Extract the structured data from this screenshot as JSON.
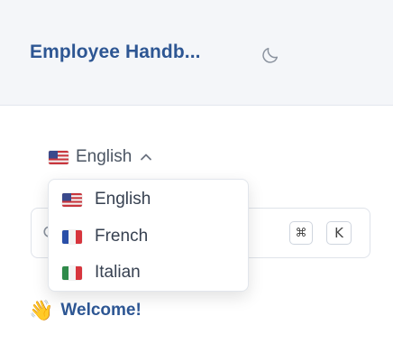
{
  "header": {
    "title": "Employee Handb...",
    "theme_toggle_icon": "moon-icon"
  },
  "language": {
    "current": "English",
    "current_flag": "us-flag",
    "toggle_icon": "chevron-up-icon",
    "options": [
      {
        "label": "English",
        "flag": "us-flag"
      },
      {
        "label": "French",
        "flag": "fr-flag"
      },
      {
        "label": "Italian",
        "flag": "it-flag"
      }
    ]
  },
  "search": {
    "icon": "search-icon",
    "shortcut_keys": [
      "⌘",
      "K"
    ]
  },
  "nav": {
    "welcome_icon": "👋",
    "welcome_label": "Welcome!"
  },
  "colors": {
    "header_bg": "#f4f6f9",
    "brand": "#2d5693"
  }
}
